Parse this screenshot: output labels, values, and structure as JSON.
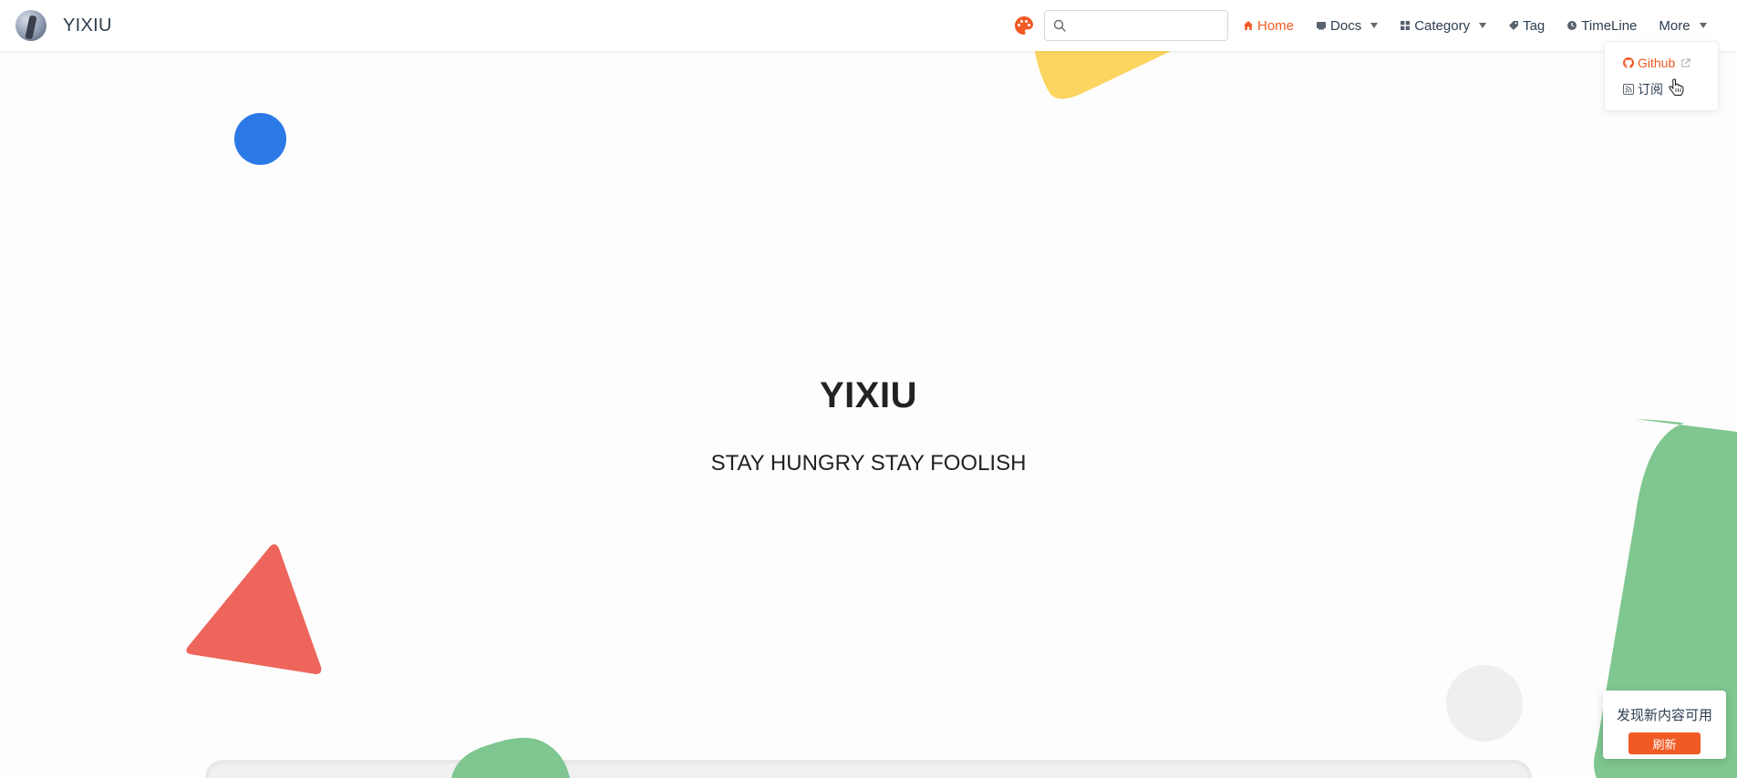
{
  "site": {
    "name": "YIXIU"
  },
  "search": {
    "placeholder": ""
  },
  "nav": {
    "items": [
      {
        "label": "Home",
        "icon": "home-icon",
        "active": true
      },
      {
        "label": "Docs",
        "icon": "book-icon",
        "dropdown": true
      },
      {
        "label": "Category",
        "icon": "category-icon",
        "dropdown": true
      },
      {
        "label": "Tag",
        "icon": "tag-icon"
      },
      {
        "label": "TimeLine",
        "icon": "clock-icon"
      },
      {
        "label": "More",
        "dropdown": true
      }
    ]
  },
  "more_menu": {
    "items": [
      {
        "label": "Github",
        "icon": "github-icon",
        "external": true
      },
      {
        "label": "订阅",
        "icon": "rss-icon"
      }
    ]
  },
  "hero": {
    "title": "YIXIU",
    "subtitle": "STAY HUNGRY STAY FOOLISH"
  },
  "update_popup": {
    "message": "发现新内容可用",
    "button_label": "刷新"
  },
  "colors": {
    "accent": "#f05a24",
    "blue": "#2b79e6",
    "yellow": "#fbd560",
    "red": "#ee655c",
    "green": "#7fc690"
  }
}
